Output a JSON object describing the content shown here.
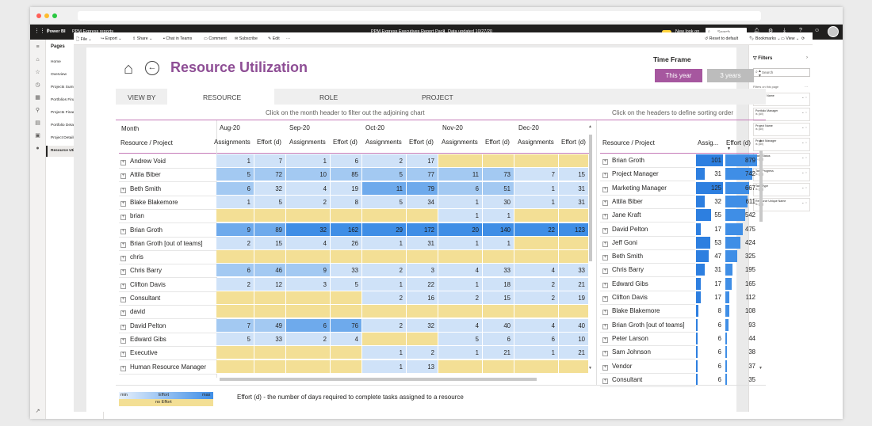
{
  "topbar": {
    "app": "Power BI",
    "workspace": "PPM Express reports",
    "report": "PPM Express Executives Report Pack",
    "updated": "Data updated 10/27/20",
    "newlook": "New look on",
    "search": "Search"
  },
  "cmdbar": {
    "file": "File",
    "export": "Export",
    "share": "Share",
    "teams": "Chat in Teams",
    "comment": "Comment",
    "subscribe": "Subscribe",
    "edit": "Edit",
    "more": "···",
    "reset": "Reset to default",
    "bookmarks": "Bookmarks",
    "view": "View"
  },
  "pages": {
    "header": "Pages",
    "items": [
      "Home",
      "Overview",
      "Projects Summary",
      "Portfolios Financials",
      "Projects Financials",
      "Portfolio Details",
      "Project Details",
      "Resource Utilization"
    ]
  },
  "filters": {
    "title": "Filters",
    "search": "Search",
    "section": "Filters on this page",
    "cards": [
      {
        "name": "Portfolio Name",
        "value": "is (All)"
      },
      {
        "name": "Portfolio Manager",
        "value": "is (All)"
      },
      {
        "name": "Project Name",
        "value": "is (All)"
      },
      {
        "name": "Project Manager",
        "value": "is (All)"
      },
      {
        "name": "Task Status",
        "value": "is (All)"
      },
      {
        "name": "Task Progress",
        "value": "is (All)"
      },
      {
        "name": "Task Type",
        "value": "is (All)"
      },
      {
        "name": "Resource Unique Name",
        "value": "is (All)"
      }
    ]
  },
  "report": {
    "title": "Resource Utilization",
    "timeframe": "Time Frame",
    "this_year": "This year",
    "three_years": "3 years",
    "viewby": "VIEW BY",
    "tab_resource": "RESOURCE",
    "tab_role": "ROLE",
    "tab_project": "PROJECT",
    "hint_left": "Click on the month header to filter out the adjoining chart",
    "hint_right": "Click on the headers to define sorting order",
    "month": "Month",
    "resource_project": "Resource / Project",
    "footnote": "Effort (d) - the number of days required to complete tasks assigned to a resource",
    "legend_min": "min",
    "legend_effort": "Effort",
    "legend_max": "max",
    "legend_noeffort": "no Effort"
  },
  "matrix": {
    "months": [
      "Aug-20",
      "Sep-20",
      "Oct-20",
      "Nov-20",
      "Dec-20"
    ],
    "subheaders": [
      "Assignments",
      "Effort (d)"
    ],
    "rows": [
      {
        "name": "Andrew Void",
        "v": [
          "1",
          "7",
          "1",
          "6",
          "2",
          "17",
          "",
          "",
          "",
          ""
        ],
        "c": [
          "b1",
          "b1",
          "b1",
          "b1",
          "b1",
          "b1",
          "y",
          "y",
          "y",
          "y"
        ]
      },
      {
        "name": "Attila Biber",
        "v": [
          "5",
          "72",
          "10",
          "85",
          "5",
          "77",
          "11",
          "73",
          "7",
          "15"
        ],
        "c": [
          "b2",
          "b2",
          "b2",
          "b2",
          "b2",
          "b2",
          "b2",
          "b2",
          "b1",
          "b1"
        ]
      },
      {
        "name": "Beth Smith",
        "v": [
          "6",
          "32",
          "4",
          "19",
          "11",
          "79",
          "6",
          "51",
          "1",
          "31"
        ],
        "c": [
          "b2",
          "b1",
          "b1",
          "b1",
          "b3",
          "b3",
          "b2",
          "b2",
          "b1",
          "b1"
        ]
      },
      {
        "name": "Blake Blakemore",
        "v": [
          "1",
          "5",
          "2",
          "8",
          "5",
          "34",
          "1",
          "30",
          "1",
          "31"
        ],
        "c": [
          "b1",
          "b1",
          "b1",
          "b1",
          "b1",
          "b1",
          "b1",
          "b1",
          "b1",
          "b1"
        ]
      },
      {
        "name": "brian",
        "v": [
          "",
          "",
          "",
          "",
          "",
          "",
          "1",
          "1",
          "",
          ""
        ],
        "c": [
          "y",
          "y",
          "y",
          "y",
          "y",
          "y",
          "b1",
          "b1",
          "y",
          "y"
        ]
      },
      {
        "name": "Brian Groth",
        "v": [
          "9",
          "89",
          "32",
          "162",
          "29",
          "172",
          "20",
          "140",
          "22",
          "123"
        ],
        "c": [
          "b3",
          "b3",
          "b4",
          "b4",
          "b4",
          "b4",
          "b4",
          "b4",
          "b4",
          "b4"
        ]
      },
      {
        "name": "Brian Groth [out of teams]",
        "v": [
          "2",
          "15",
          "4",
          "26",
          "1",
          "31",
          "1",
          "1",
          "",
          ""
        ],
        "c": [
          "b1",
          "b1",
          "b1",
          "b1",
          "b1",
          "b1",
          "b1",
          "b1",
          "y",
          "y"
        ]
      },
      {
        "name": "chris",
        "v": [
          "",
          "",
          "",
          "",
          "",
          "",
          "",
          "",
          "",
          ""
        ],
        "c": [
          "y",
          "y",
          "y",
          "y",
          "y",
          "y",
          "y",
          "y",
          "y",
          "y"
        ]
      },
      {
        "name": "Chris Barry",
        "v": [
          "6",
          "46",
          "9",
          "33",
          "2",
          "3",
          "4",
          "33",
          "4",
          "33"
        ],
        "c": [
          "b2",
          "b2",
          "b2",
          "b1",
          "b1",
          "b1",
          "b1",
          "b1",
          "b1",
          "b1"
        ]
      },
      {
        "name": "Clifton Davis",
        "v": [
          "2",
          "12",
          "3",
          "5",
          "1",
          "22",
          "1",
          "18",
          "2",
          "21"
        ],
        "c": [
          "b1",
          "b1",
          "b1",
          "b1",
          "b1",
          "b1",
          "b1",
          "b1",
          "b1",
          "b1"
        ]
      },
      {
        "name": "Consultant",
        "v": [
          "",
          "",
          "",
          "",
          "2",
          "16",
          "2",
          "15",
          "2",
          "19"
        ],
        "c": [
          "y",
          "y",
          "y",
          "y",
          "b1",
          "b1",
          "b1",
          "b1",
          "b1",
          "b1"
        ]
      },
      {
        "name": "david",
        "v": [
          "",
          "",
          "",
          "",
          "",
          "",
          "",
          "",
          "",
          ""
        ],
        "c": [
          "y",
          "y",
          "y",
          "y",
          "y",
          "y",
          "y",
          "y",
          "y",
          "y"
        ]
      },
      {
        "name": "David Pelton",
        "v": [
          "7",
          "49",
          "6",
          "76",
          "2",
          "32",
          "4",
          "40",
          "4",
          "40"
        ],
        "c": [
          "b2",
          "b2",
          "b3",
          "b3",
          "b1",
          "b1",
          "b1",
          "b1",
          "b1",
          "b1"
        ]
      },
      {
        "name": "Edward Gibs",
        "v": [
          "5",
          "33",
          "2",
          "4",
          "",
          "",
          "5",
          "6",
          "6",
          "10"
        ],
        "c": [
          "b1",
          "b1",
          "b1",
          "b1",
          "y",
          "y",
          "b1",
          "b1",
          "b1",
          "b1"
        ]
      },
      {
        "name": "Executive",
        "v": [
          "",
          "",
          "",
          "",
          "1",
          "2",
          "1",
          "21",
          "1",
          "21"
        ],
        "c": [
          "y",
          "y",
          "y",
          "y",
          "b1",
          "b1",
          "b1",
          "b1",
          "b1",
          "b1"
        ]
      },
      {
        "name": "Human Resource Manager",
        "v": [
          "",
          "",
          "",
          "",
          "1",
          "13",
          "",
          "",
          "",
          ""
        ],
        "c": [
          "y",
          "y",
          "y",
          "y",
          "b1",
          "b1",
          "y",
          "y",
          "y",
          "y"
        ]
      }
    ]
  },
  "ranking": {
    "header_name": "Resource / Project",
    "header_assign": "Assig...",
    "header_effort": "Effort (d)",
    "rows": [
      {
        "name": "Brian Groth",
        "a": "101",
        "e": "879",
        "af": 1.0,
        "ef": 1.0
      },
      {
        "name": "Project Manager",
        "a": "31",
        "e": "742",
        "af": 0.31,
        "ef": 0.84
      },
      {
        "name": "Marketing Manager",
        "a": "125",
        "e": "667",
        "af": 1.0,
        "ef": 0.76
      },
      {
        "name": "Attila Biber",
        "a": "32",
        "e": "611",
        "af": 0.32,
        "ef": 0.7
      },
      {
        "name": "Jane Kraft",
        "a": "55",
        "e": "542",
        "af": 0.55,
        "ef": 0.62
      },
      {
        "name": "David Pelton",
        "a": "17",
        "e": "475",
        "af": 0.17,
        "ef": 0.54
      },
      {
        "name": "Jeff Goni",
        "a": "53",
        "e": "424",
        "af": 0.53,
        "ef": 0.48
      },
      {
        "name": "Beth Smith",
        "a": "47",
        "e": "325",
        "af": 0.47,
        "ef": 0.37
      },
      {
        "name": "Chris Barry",
        "a": "31",
        "e": "195",
        "af": 0.31,
        "ef": 0.22
      },
      {
        "name": "Edward Gibs",
        "a": "17",
        "e": "165",
        "af": 0.17,
        "ef": 0.19
      },
      {
        "name": "Clifton Davis",
        "a": "17",
        "e": "112",
        "af": 0.17,
        "ef": 0.13
      },
      {
        "name": "Blake Blakemore",
        "a": "8",
        "e": "108",
        "af": 0.08,
        "ef": 0.12
      },
      {
        "name": "Brian Groth [out of teams]",
        "a": "6",
        "e": "93",
        "af": 0.06,
        "ef": 0.11
      },
      {
        "name": "Peter Larson",
        "a": "6",
        "e": "44",
        "af": 0.06,
        "ef": 0.05
      },
      {
        "name": "Sam Johnson",
        "a": "6",
        "e": "38",
        "af": 0.06,
        "ef": 0.04
      },
      {
        "name": "Vendor",
        "a": "6",
        "e": "37",
        "af": 0.06,
        "ef": 0.04
      },
      {
        "name": "Consultant",
        "a": "6",
        "e": "35",
        "af": 0.06,
        "ef": 0.04
      }
    ]
  },
  "colors": {
    "accent": "#8e4e95",
    "this_year": "#a6579f",
    "no_effort": "#f3df95",
    "b1": "#cfe2f8",
    "b2": "#a3c9f2",
    "b3": "#6eaaec",
    "b4": "#3f8ee6",
    "bar_a": "#2d7fe0",
    "bar_e": "#3f8ee6"
  }
}
